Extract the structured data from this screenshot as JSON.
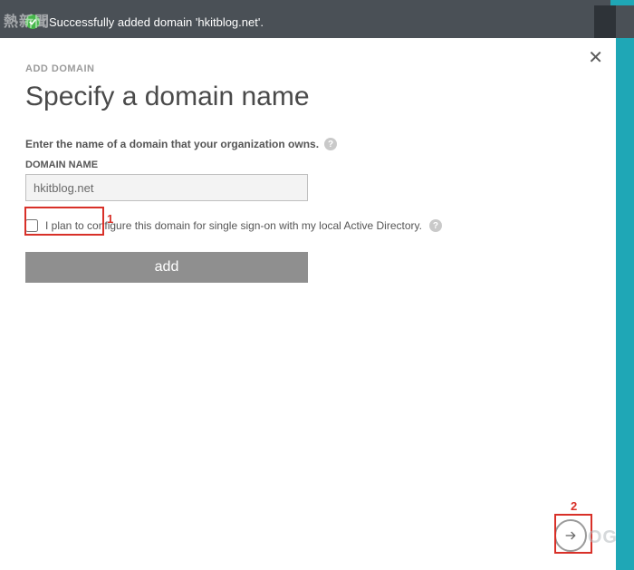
{
  "notification": {
    "message": "Successfully added domain 'hkitblog.net'."
  },
  "dialog": {
    "breadcrumb": "ADD DOMAIN",
    "title": "Specify a domain name",
    "instruction": "Enter the name of a domain that your organization owns.",
    "field_label": "DOMAIN NAME",
    "domain_value": "hkitblog.net",
    "sso_label": "I plan to configure this domain for single sign-on with my local Active Directory.",
    "add_button": "add"
  },
  "annotations": {
    "callout1": "1",
    "callout2": "2"
  },
  "watermark": {
    "top": "熱新聞",
    "bottom": "OG"
  }
}
